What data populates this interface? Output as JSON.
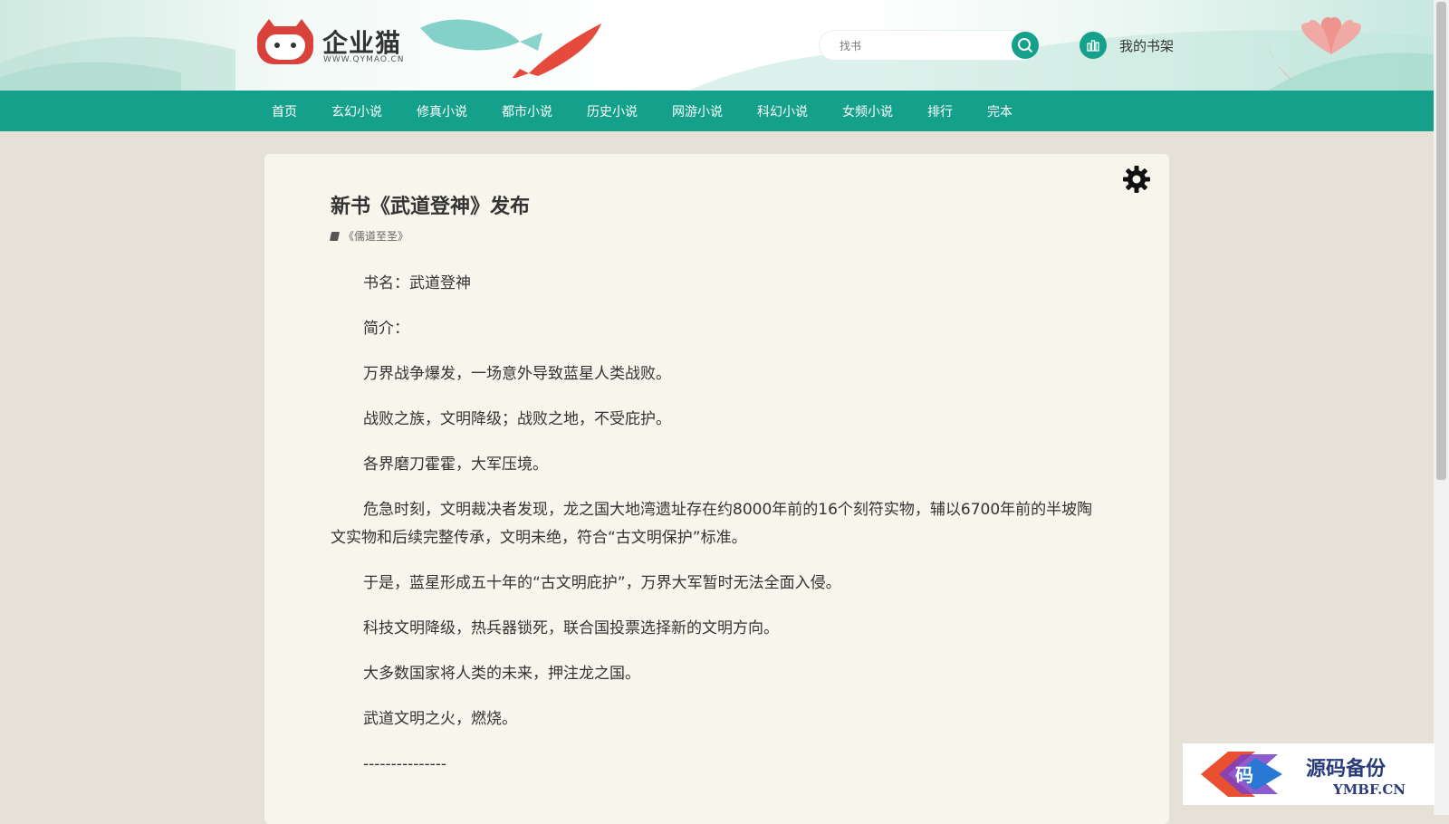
{
  "header": {
    "logo_text": "企业猫",
    "logo_sub": "WWW.QYMAO.CN",
    "search_placeholder": "找书",
    "shelf_label": "我的书架"
  },
  "nav": {
    "items": [
      "首页",
      "玄幻小说",
      "修真小说",
      "都市小说",
      "历史小说",
      "网游小说",
      "科幻小说",
      "女频小说",
      "排行",
      "完本"
    ]
  },
  "article": {
    "title": "新书《武道登神》发布",
    "book_ref": "《儒道至圣》",
    "paragraphs": [
      "书名：武道登神",
      "简介：",
      "万界战争爆发，一场意外导致蓝星人类战败。",
      "战败之族，文明降级；战败之地，不受庇护。",
      "各界磨刀霍霍，大军压境。",
      "危急时刻，文明裁决者发现，龙之国大地湾遗址存在约8000年前的16个刻符实物，辅以6700年前的半坡陶文实物和后续完整传承，文明未绝，符合“古文明保护”标准。",
      "于是，蓝星形成五十年的“古文明庇护”，万界大军暂时无法全面入侵。",
      "科技文明降级，热兵器锁死，联合国投票选择新的文明方向。",
      "大多数国家将人类的未来，押注龙之国。",
      "武道文明之火，燃烧。",
      "---------------"
    ]
  },
  "watermark": {
    "cn": "源码备份",
    "en": "YMBF.CN",
    "glyph": "码"
  },
  "colors": {
    "accent": "#14a08a",
    "page_bg": "#e5e1d6",
    "card_bg": "#f8f5ec"
  }
}
